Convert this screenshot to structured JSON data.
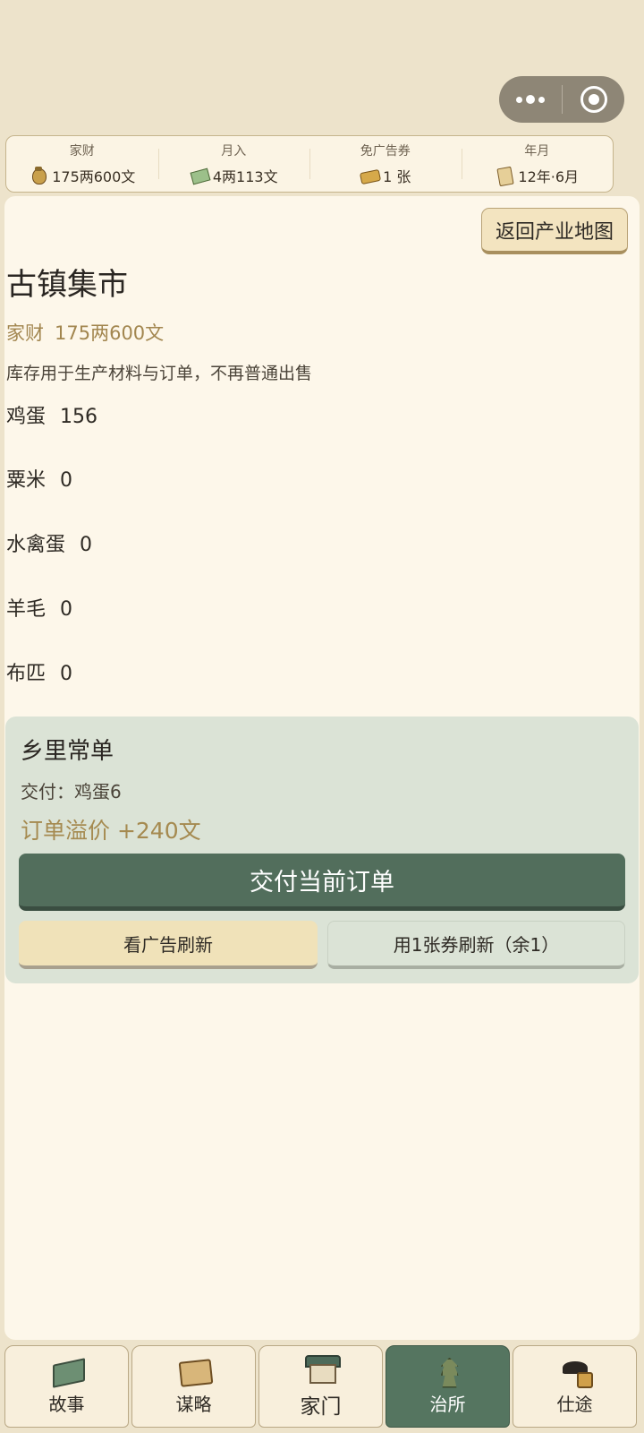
{
  "capsule": {
    "more_icon": "more-dots-icon",
    "close_icon": "target-circle-icon"
  },
  "stats": [
    {
      "label": "家财",
      "value": "175两600文",
      "icon": "money-bag-icon"
    },
    {
      "label": "月入",
      "value": "4两113文",
      "icon": "banknote-icon"
    },
    {
      "label": "免广告券",
      "value": "1 张",
      "icon": "ticket-icon"
    },
    {
      "label": "年月",
      "value": "12年·6月",
      "icon": "scroll-icon"
    }
  ],
  "page": {
    "back_button": "返回产业地图",
    "title": "古镇集市",
    "wealth_label": "家财",
    "wealth_value": "175两600文",
    "note": "库存用于生产材料与订单，不再普通出售"
  },
  "inventory": [
    {
      "name": "鸡蛋",
      "count": "156"
    },
    {
      "name": "粟米",
      "count": "0"
    },
    {
      "name": "水禽蛋",
      "count": "0"
    },
    {
      "name": "羊毛",
      "count": "0"
    },
    {
      "name": "布匹",
      "count": "0"
    }
  ],
  "order": {
    "title": "乡里常单",
    "requirement": "交付：鸡蛋6",
    "bonus": "订单溢价 +240文",
    "deliver_button": "交付当前订单",
    "ad_refresh_button": "看广告刷新",
    "coupon_refresh_button": "用1张券刷新（余1）"
  },
  "tabs": [
    {
      "label": "故事",
      "icon": "book-icon"
    },
    {
      "label": "谋略",
      "icon": "map-scroll-icon"
    },
    {
      "label": "家门",
      "icon": "house-icon"
    },
    {
      "label": "治所",
      "icon": "tower-icon",
      "active": true
    },
    {
      "label": "仕途",
      "icon": "official-hat-icon"
    }
  ],
  "colors": {
    "accent": "#526e5c",
    "gold_text": "#a2864f",
    "background": "#ede3cb"
  }
}
